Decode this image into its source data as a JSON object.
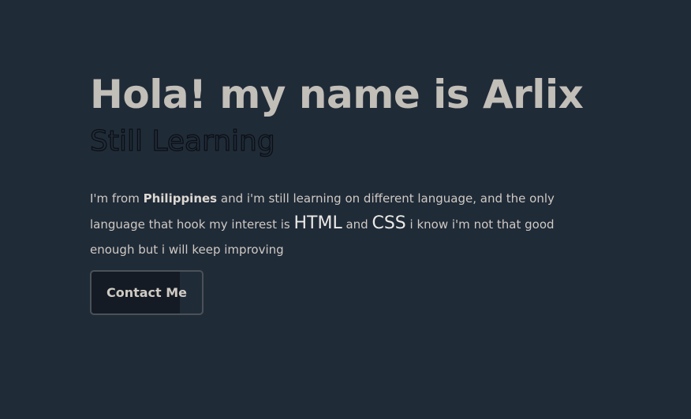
{
  "hero": {
    "title": "Hola! my name is Arlix",
    "subtitle": "Still Learning",
    "intro": {
      "part1": "I'm from ",
      "country": "Philippines",
      "part2": " and i'm still learning on different language, and the only language that hook my interest is ",
      "lang1": "HTML",
      "and": " and ",
      "lang2": "CSS",
      "part3": " i know i'm not that good enough but i will keep improving"
    },
    "contact_button": "Contact Me"
  }
}
